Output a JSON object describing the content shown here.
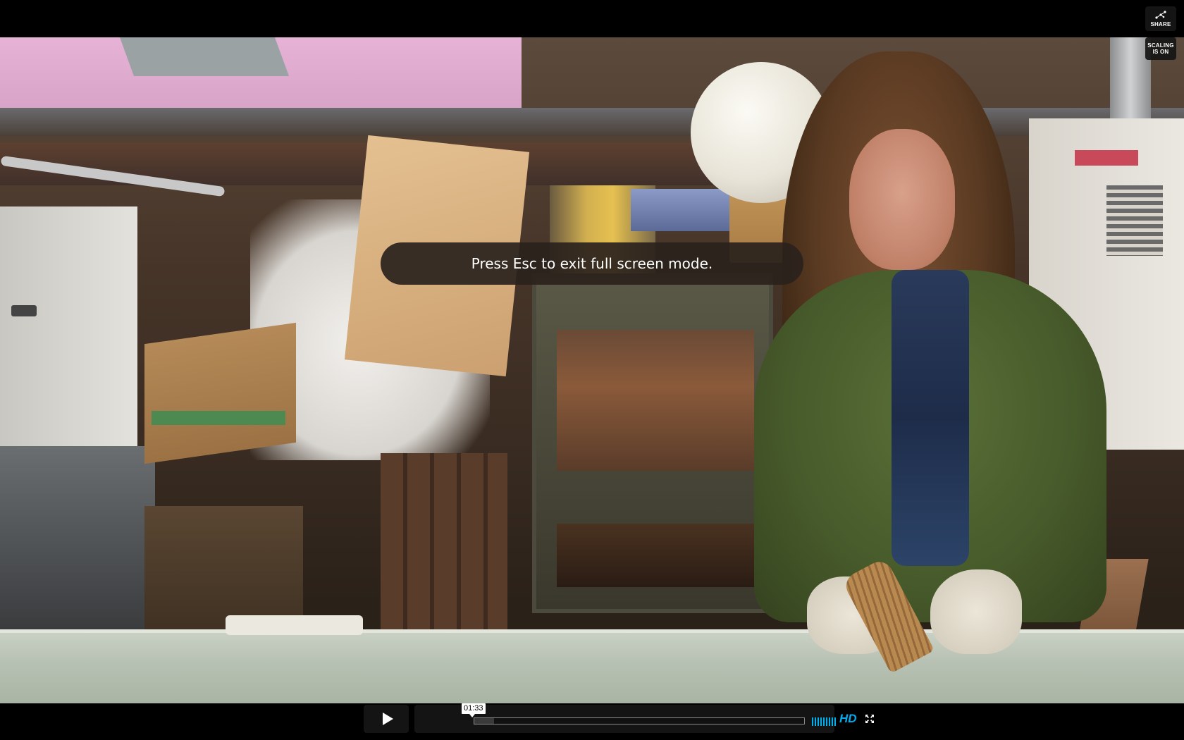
{
  "overlay": {
    "esc_message": "Press Esc to exit full screen mode."
  },
  "side_buttons": {
    "share_label": "SHARE",
    "scaling_label": "SCALING IS ON"
  },
  "controls": {
    "current_time": "01:33",
    "progress_fraction": 0.06,
    "volume_bars": 9,
    "hd_label": "HD"
  },
  "colors": {
    "accent": "#00adef",
    "panel": "#161616"
  },
  "icons": {
    "play": "play-icon",
    "share": "share-icon",
    "fullscreen": "fullscreen-icon"
  }
}
